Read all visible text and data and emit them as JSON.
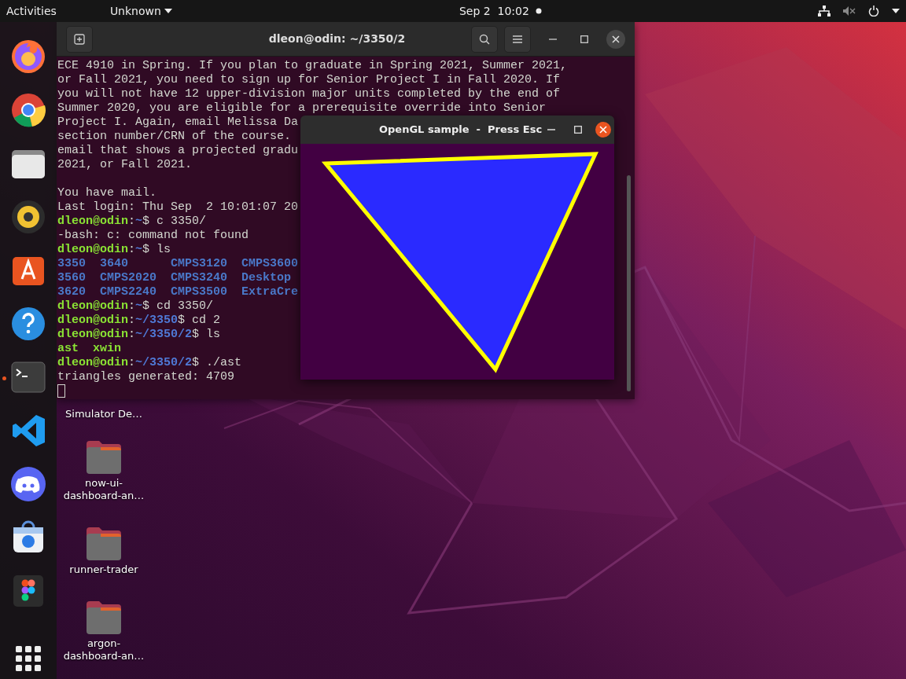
{
  "top_bar": {
    "activities": "Activities",
    "app_menu": "Unknown",
    "clock": "Sep 2  10:02",
    "notification": true
  },
  "dock": {
    "items": [
      {
        "running": false
      },
      {
        "running": false
      },
      {
        "running": false
      },
      {
        "running": false
      },
      {
        "running": false
      },
      {
        "running": false
      },
      {
        "running": true
      },
      {
        "running": false
      },
      {
        "running": false
      },
      {
        "running": false
      },
      {
        "running": false
      }
    ]
  },
  "terminal": {
    "title": "dleon@odin: ~/3350/2",
    "cursor": true,
    "lines": [
      [
        {
          "kind": "plain",
          "text": "ECE 4910 in Spring. If you plan to graduate in Spring 2021, Summer 2021,"
        }
      ],
      [
        {
          "kind": "plain",
          "text": "or Fall 2021, you need to sign up for Senior Project I in Fall 2020. If"
        }
      ],
      [
        {
          "kind": "plain",
          "text": "you will not have 12 upper-division major units completed by the end of"
        }
      ],
      [
        {
          "kind": "plain",
          "text": "Summer 2020, you are eligible for a prerequisite override into Senior"
        }
      ],
      [
        {
          "kind": "plain",
          "text": "Project I. Again, email Melissa Da"
        }
      ],
      [
        {
          "kind": "plain",
          "text": "section number/CRN of the course."
        }
      ],
      [
        {
          "kind": "plain",
          "text": "email that shows a projected gradu"
        }
      ],
      [
        {
          "kind": "plain",
          "text": "2021, or Fall 2021."
        }
      ],
      [
        {
          "kind": "plain",
          "text": "You have mail.",
          "gap_before": true
        }
      ],
      [
        {
          "kind": "plain",
          "text": "Last login: Thu Sep  2 10:01:07 20"
        }
      ],
      [
        {
          "kind": "user",
          "text": "dleon@odin"
        },
        {
          "kind": "plain",
          "text": ":"
        },
        {
          "kind": "path",
          "text": "~"
        },
        {
          "kind": "plain",
          "text": "$ c 3350/"
        }
      ],
      [
        {
          "kind": "plain",
          "text": "-bash: c: command not found"
        }
      ],
      [
        {
          "kind": "user",
          "text": "dleon@odin"
        },
        {
          "kind": "plain",
          "text": ":"
        },
        {
          "kind": "path",
          "text": "~"
        },
        {
          "kind": "plain",
          "text": "$ ls"
        }
      ],
      [
        {
          "kind": "dir",
          "text": "3350  3640      CMPS3120  CMPS3600"
        }
      ],
      [
        {
          "kind": "dir",
          "text": "3560  CMPS2020  CMPS3240  Desktop"
        }
      ],
      [
        {
          "kind": "dir",
          "text": "3620  CMPS2240  CMPS3500  ExtraCre"
        }
      ],
      [
        {
          "kind": "user",
          "text": "dleon@odin"
        },
        {
          "kind": "plain",
          "text": ":"
        },
        {
          "kind": "path",
          "text": "~"
        },
        {
          "kind": "plain",
          "text": "$ cd 3350/"
        }
      ],
      [
        {
          "kind": "user",
          "text": "dleon@odin"
        },
        {
          "kind": "plain",
          "text": ":"
        },
        {
          "kind": "path",
          "text": "~/3350"
        },
        {
          "kind": "plain",
          "text": "$ cd 2"
        }
      ],
      [
        {
          "kind": "user",
          "text": "dleon@odin"
        },
        {
          "kind": "plain",
          "text": ":"
        },
        {
          "kind": "path",
          "text": "~/3350/2"
        },
        {
          "kind": "plain",
          "text": "$ ls"
        }
      ],
      [
        {
          "kind": "exec",
          "text": "ast  xwin"
        }
      ],
      [
        {
          "kind": "user",
          "text": "dleon@odin"
        },
        {
          "kind": "plain",
          "text": ":"
        },
        {
          "kind": "path",
          "text": "~/3350/2"
        },
        {
          "kind": "plain",
          "text": "$ ./ast"
        }
      ],
      [
        {
          "kind": "plain",
          "text": "triangles generated: 4709"
        }
      ]
    ]
  },
  "gl_window": {
    "title": "OpenGL sample  -  Press Esc"
  },
  "desktop_icons": [
    {
      "kind": "label-only",
      "label": "Simulator De…"
    },
    {
      "kind": "folder",
      "label": "now-ui-dashboard-an…"
    },
    {
      "kind": "folder",
      "label": "runner-trader"
    },
    {
      "kind": "folder",
      "label": "argon-dashboard-an…"
    }
  ]
}
